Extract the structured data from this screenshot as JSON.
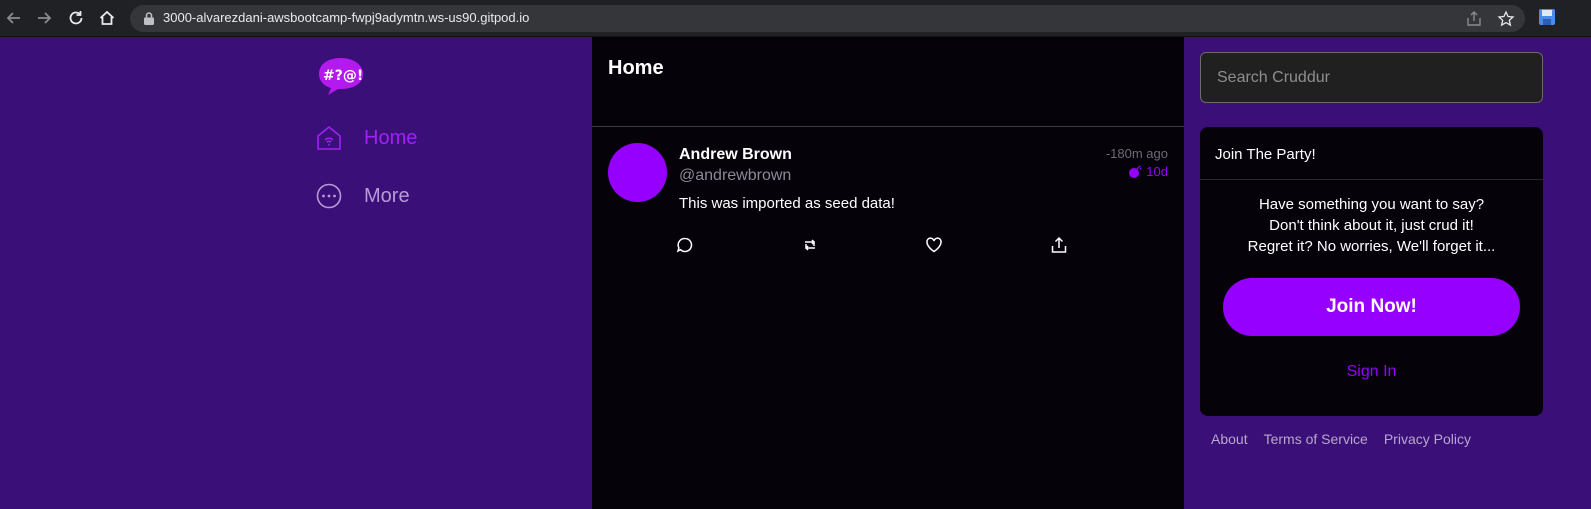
{
  "browser": {
    "url": "3000-alvarezdani-awsbootcamp-fwpj9adymtn.ws-us90.gitpod.io"
  },
  "nav": {
    "items": [
      {
        "label": "Home",
        "icon": "home-icon"
      },
      {
        "label": "More",
        "icon": "more-icon"
      }
    ]
  },
  "feed": {
    "title": "Home",
    "posts": [
      {
        "display_name": "Andrew Brown",
        "handle": "@andrewbrown",
        "time_ago": "-180m ago",
        "expires": "10d",
        "message": "This was imported as seed data!"
      }
    ]
  },
  "sidebar": {
    "search_placeholder": "Search Cruddur",
    "join": {
      "title": "Join The Party!",
      "lines": [
        "Have something you want to say?",
        "Don't think about it, just crud it!",
        "Regret it? No worries, We'll forget it..."
      ],
      "button": "Join Now!",
      "signin": "Sign In"
    },
    "footer": [
      "About",
      "Terms of Service",
      "Privacy Policy"
    ]
  },
  "colors": {
    "accent": "#9500ff",
    "background": "#3b0f78",
    "feed_bg": "#06020a"
  }
}
